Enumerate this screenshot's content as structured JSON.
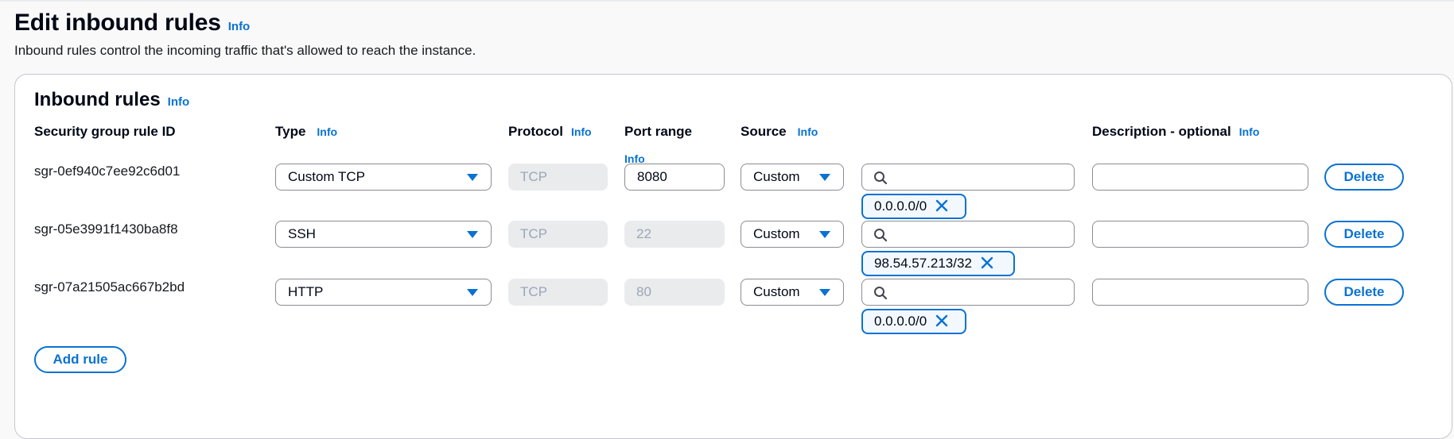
{
  "page": {
    "title": "Edit inbound rules",
    "info": "Info",
    "description": "Inbound rules control the incoming traffic that's allowed to reach the instance."
  },
  "panel": {
    "title": "Inbound rules",
    "info": "Info",
    "columns": {
      "rule_id": "Security group rule ID",
      "type": "Type",
      "protocol": "Protocol",
      "port_range": "Port range",
      "source": "Source",
      "description": "Description - optional",
      "info": "Info"
    },
    "rules": [
      {
        "id": "sgr-0ef940c7ee92c6d01",
        "type": "Custom TCP",
        "protocol": "TCP",
        "port_range": "8080",
        "source": "Custom",
        "search_value": "",
        "cidr": "0.0.0.0/0",
        "description": "",
        "delete_label": "Delete"
      },
      {
        "id": "sgr-05e3991f1430ba8f8",
        "type": "SSH",
        "protocol": "TCP",
        "port_range": "22",
        "source": "Custom",
        "search_value": "",
        "cidr": "98.54.57.213/32",
        "description": "",
        "delete_label": "Delete"
      },
      {
        "id": "sgr-07a21505ac667b2bd",
        "type": "HTTP",
        "protocol": "TCP",
        "port_range": "80",
        "source": "Custom",
        "search_value": "",
        "cidr": "0.0.0.0/0",
        "description": "",
        "delete_label": "Delete"
      }
    ],
    "add_rule_label": "Add rule"
  },
  "icons": {
    "caret": "caret-down-icon",
    "search": "search-icon",
    "remove": "close-icon"
  },
  "colors": {
    "accent": "#0972d3",
    "text": "#000716",
    "border": "#8c8c94",
    "disabled_bg": "#e9ebed"
  }
}
